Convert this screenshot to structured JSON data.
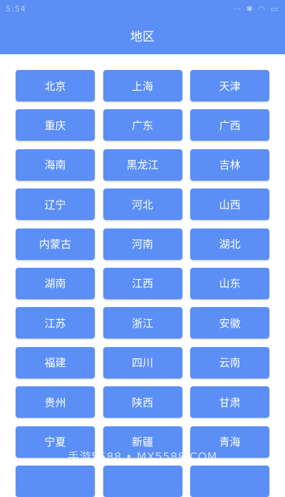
{
  "status_bar": {
    "time": "5:54",
    "icons": "⋯ ✱ ◠ ▭"
  },
  "header": {
    "title": "地区"
  },
  "regions": [
    "北京",
    "上海",
    "天津",
    "重庆",
    "广东",
    "广西",
    "海南",
    "黑龙江",
    "吉林",
    "辽宁",
    "河北",
    "山西",
    "内蒙古",
    "河南",
    "湖北",
    "湖南",
    "江西",
    "山东",
    "江苏",
    "浙江",
    "安徽",
    "福建",
    "四川",
    "云南",
    "贵州",
    "陕西",
    "甘肃",
    "宁夏",
    "新疆",
    "青海",
    "",
    "",
    ""
  ],
  "watermark": "手游5588 • MX5588.COM",
  "colors": {
    "primary": "#5b8ff5",
    "button_text": "#ffffff",
    "background": "#ffffff"
  }
}
